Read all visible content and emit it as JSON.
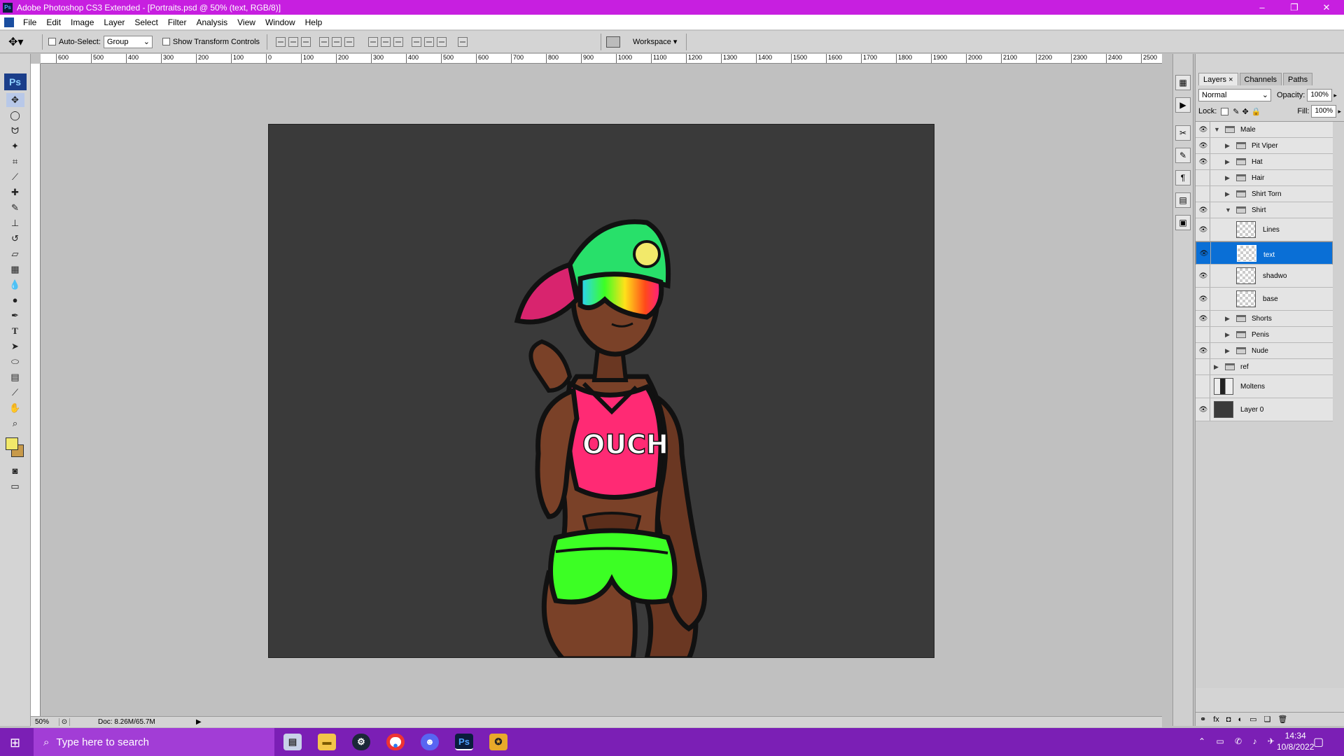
{
  "window": {
    "title": "Adobe Photoshop CS3 Extended - [Portraits.psd @ 50% (text, RGB/8)]",
    "ps_icon": "Ps",
    "minimize": "–",
    "restore": "❐",
    "close": "✕"
  },
  "menu": [
    "File",
    "Edit",
    "Image",
    "Layer",
    "Select",
    "Filter",
    "Analysis",
    "View",
    "Window",
    "Help"
  ],
  "options": {
    "auto_select_label": "Auto-Select:",
    "auto_select_value": "Group",
    "transform_label": "Show Transform Controls",
    "workspace_label": "Workspace ▾"
  },
  "ruler_labels": [
    "600",
    "500",
    "400",
    "300",
    "200",
    "100",
    "0",
    "100",
    "200",
    "300",
    "400",
    "500",
    "600",
    "700",
    "800",
    "900",
    "1000",
    "1100",
    "1200",
    "1300",
    "1400",
    "1500",
    "1600",
    "1700",
    "1800",
    "1900",
    "2000",
    "2100",
    "2200",
    "2300",
    "2400",
    "2500"
  ],
  "toolbox": {
    "logo": "Ps",
    "foreground_color": "#f2e96a",
    "background_color": "#c89a4a"
  },
  "artwork": {
    "shirt_text": "OUCH",
    "skin": "#7a4128",
    "shirt": "#ff2a74",
    "shorts": "#3cff24",
    "cap": "#28e06a",
    "brim": "#d8246e"
  },
  "status": {
    "zoom": "50%",
    "doc": "Doc: 8.26M/65.7M"
  },
  "panel": {
    "tabs": [
      "Layers",
      "Channels",
      "Paths"
    ],
    "blend_mode": "Normal",
    "opacity_label": "Opacity:",
    "opacity_value": "100%",
    "lock_label": "Lock:",
    "fill_label": "Fill:",
    "fill_value": "100%",
    "layers": [
      {
        "name": "Male",
        "type": "group",
        "expanded": true,
        "visible": true,
        "indent": 0
      },
      {
        "name": "Pit Viper",
        "type": "group",
        "expanded": false,
        "visible": true,
        "indent": 1
      },
      {
        "name": "Hat",
        "type": "group",
        "expanded": false,
        "visible": true,
        "indent": 1
      },
      {
        "name": "Hair",
        "type": "group",
        "expanded": false,
        "visible": false,
        "indent": 1
      },
      {
        "name": "Shirt Torn",
        "type": "group",
        "expanded": false,
        "visible": false,
        "indent": 1
      },
      {
        "name": "Shirt",
        "type": "group",
        "expanded": true,
        "visible": true,
        "indent": 1
      },
      {
        "name": "Lines",
        "type": "layer",
        "visible": true,
        "indent": 2
      },
      {
        "name": "text",
        "type": "layer",
        "visible": true,
        "indent": 2,
        "selected": true
      },
      {
        "name": "shadwo",
        "type": "layer",
        "visible": true,
        "indent": 2
      },
      {
        "name": "base",
        "type": "layer",
        "visible": true,
        "indent": 2
      },
      {
        "name": "Shorts",
        "type": "group",
        "expanded": false,
        "visible": true,
        "indent": 1
      },
      {
        "name": "Penis",
        "type": "group",
        "expanded": false,
        "visible": false,
        "indent": 1
      },
      {
        "name": "Nude",
        "type": "group",
        "expanded": false,
        "visible": true,
        "indent": 1
      },
      {
        "name": "ref",
        "type": "group",
        "expanded": false,
        "visible": false,
        "indent": 0
      },
      {
        "name": "Moltens",
        "type": "image",
        "visible": false,
        "indent": 0
      },
      {
        "name": "Layer 0",
        "type": "fill",
        "visible": true,
        "indent": 0
      }
    ]
  },
  "taskbar": {
    "search_placeholder": "Type here to search",
    "time": "14:34",
    "date": "10/8/2022"
  }
}
